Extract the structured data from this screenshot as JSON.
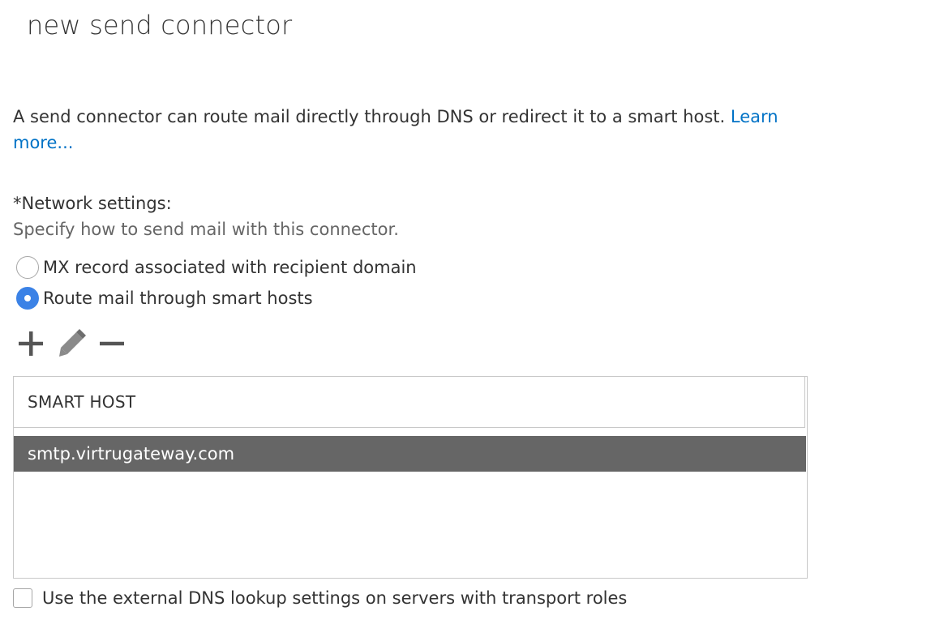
{
  "dialog": {
    "title": "new send connector"
  },
  "intro": {
    "text": "A send connector can route mail directly through DNS or redirect it to a smart host. ",
    "link_label": "Learn more..."
  },
  "network": {
    "label": "*Network settings:",
    "description": "Specify how to send mail with this connector.",
    "options": [
      {
        "label": "MX record associated with recipient domain",
        "selected": false
      },
      {
        "label": "Route mail through smart hosts",
        "selected": true
      }
    ]
  },
  "toolbar": {
    "add_icon": "plus-icon",
    "edit_icon": "pencil-icon",
    "remove_icon": "minus-icon"
  },
  "grid": {
    "column_header": "SMART HOST",
    "rows": [
      {
        "smart_host": "smtp.virtrugateway.com",
        "selected": true
      }
    ]
  },
  "dns_lookup": {
    "label": "Use the external DNS lookup settings on servers with transport roles",
    "checked": false
  },
  "colors": {
    "accent": "#3b82e6",
    "link": "#0072c6",
    "selected_row": "#666666"
  }
}
